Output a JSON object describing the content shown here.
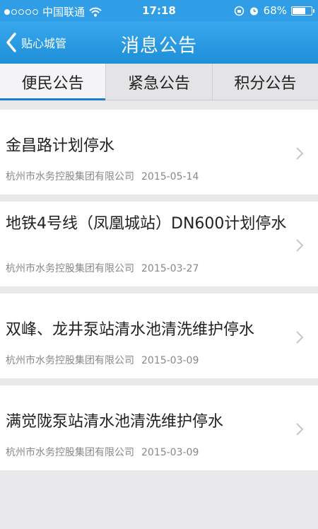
{
  "status_bar": {
    "carrier": "中国联通",
    "time": "17:18",
    "battery": "68%",
    "battery_level": 0.68,
    "icons": [
      "signal-dots",
      "wifi-icon",
      "lock-rotation-icon",
      "alarm-icon",
      "battery-icon"
    ]
  },
  "nav": {
    "back_label": "贴心城管",
    "title": "消息公告"
  },
  "tabs": [
    {
      "label": "便民公告",
      "active": true
    },
    {
      "label": "紧急公告",
      "active": false
    },
    {
      "label": "积分公告",
      "active": false
    }
  ],
  "items": [
    {
      "title": "金昌路计划停水",
      "source": "杭州市水务控股集团有限公司",
      "date": "2015-05-14"
    },
    {
      "title": "地铁4号线（凤凰城站）DN600计划停水",
      "source": "杭州市水务控股集团有限公司",
      "date": "2015-03-27"
    },
    {
      "title": "双峰、龙井泵站清水池清洗维护停水",
      "source": "杭州市水务控股集团有限公司",
      "date": "2015-03-09"
    },
    {
      "title": "满觉陇泵站清水池清洗维护停水",
      "source": "杭州市水务控股集团有限公司",
      "date": "2015-03-09"
    }
  ],
  "colors": {
    "nav": "#2f9ee6",
    "active_tab_indicator": "#1a7fce"
  }
}
